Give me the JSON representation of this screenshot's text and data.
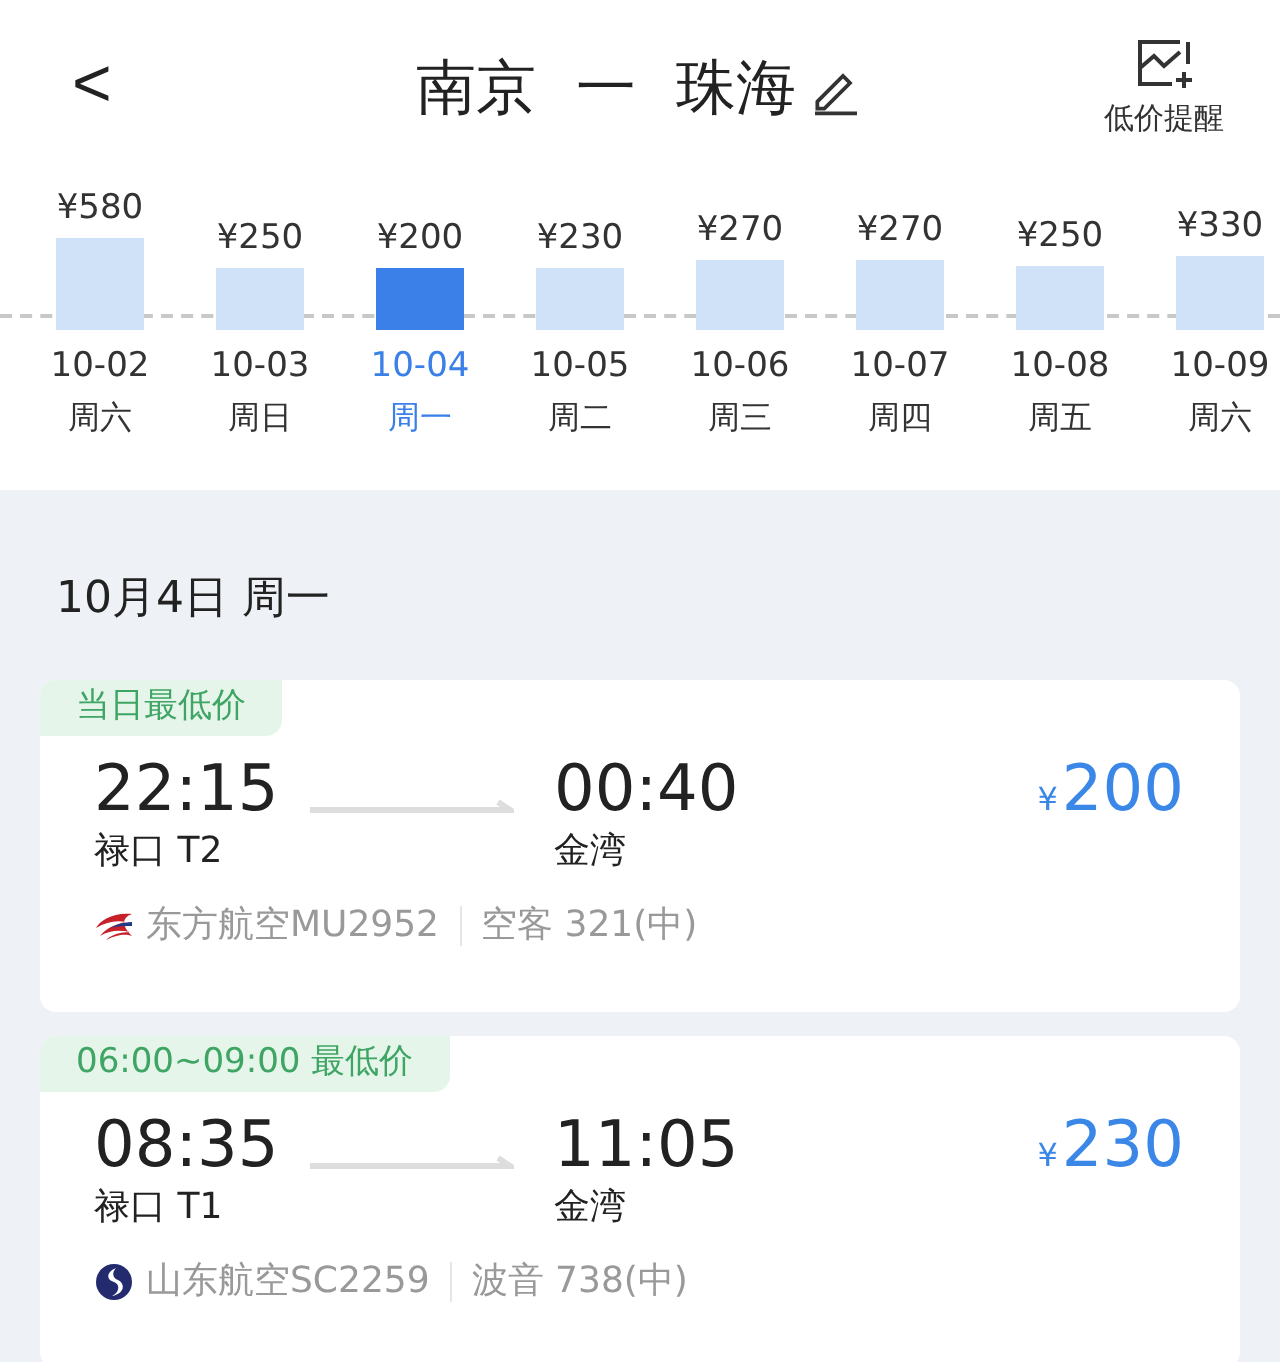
{
  "header": {
    "back": "<",
    "origin": "南京",
    "separator": "一",
    "destination": "珠海",
    "alert_label": "低价提醒"
  },
  "days": [
    {
      "price": "¥580",
      "date": "10-02",
      "weekday": "周六",
      "selected": false
    },
    {
      "price": "¥250",
      "date": "10-03",
      "weekday": "周日",
      "selected": false
    },
    {
      "price": "¥200",
      "date": "10-04",
      "weekday": "周一",
      "selected": true
    },
    {
      "price": "¥230",
      "date": "10-05",
      "weekday": "周二",
      "selected": false
    },
    {
      "price": "¥270",
      "date": "10-06",
      "weekday": "周三",
      "selected": false
    },
    {
      "price": "¥270",
      "date": "10-07",
      "weekday": "周四",
      "selected": false
    },
    {
      "price": "¥250",
      "date": "10-08",
      "weekday": "周五",
      "selected": false
    },
    {
      "price": "¥330",
      "date": "10-09",
      "weekday": "周六",
      "selected": false
    }
  ],
  "date_heading": "10月4日 周一",
  "flights": [
    {
      "tag": "当日最低价",
      "depart_time": "22:15",
      "depart_airport": "禄口 T2",
      "arrive_time": "00:40",
      "arrive_airport": "金湾",
      "currency": "¥",
      "price": "200",
      "airline": "东方航空MU2952",
      "aircraft": "空客 321(中)",
      "kind": "swallow"
    },
    {
      "tag": "06:00~09:00 最低价",
      "depart_time": "08:35",
      "depart_airport": "禄口 T1",
      "arrive_time": "11:05",
      "arrive_airport": "金湾",
      "currency": "¥",
      "price": "230",
      "airline": "山东航空SC2259",
      "aircraft": "波音 738(中)",
      "kind": "circle"
    }
  ]
}
